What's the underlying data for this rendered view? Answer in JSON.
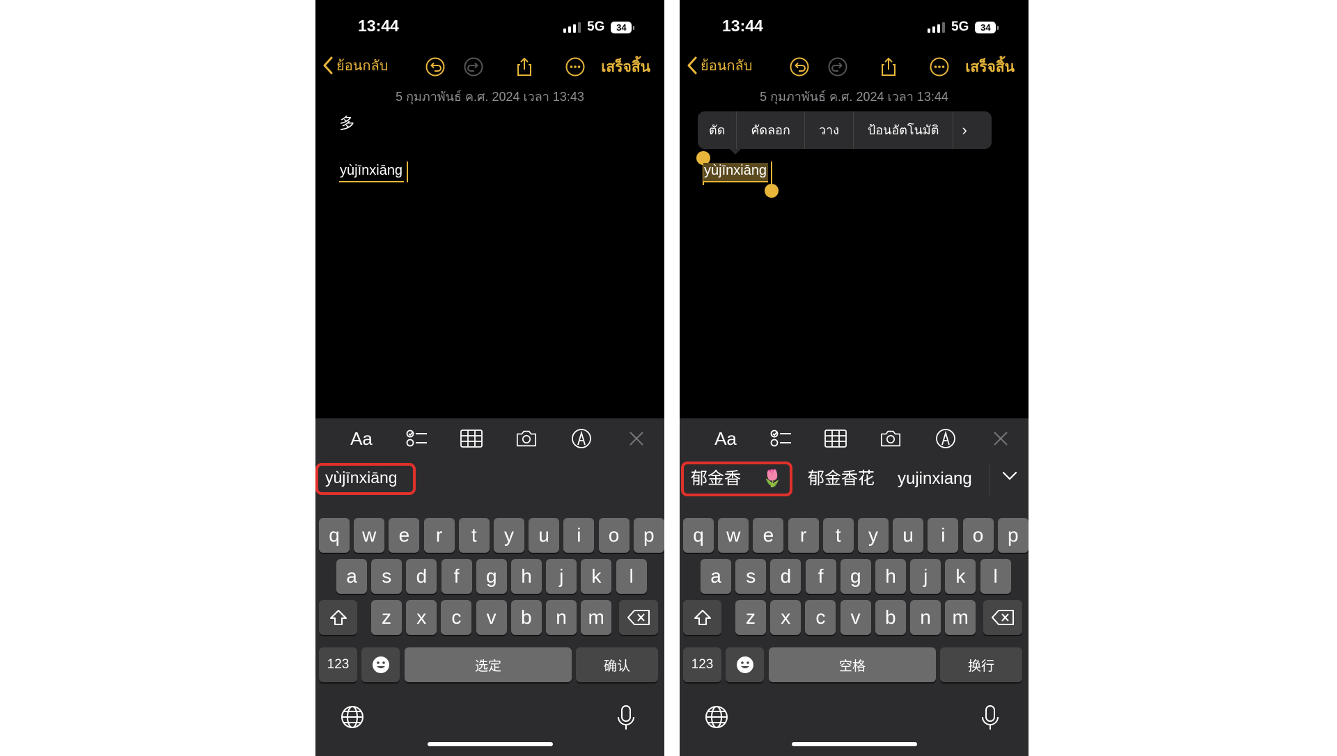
{
  "left": {
    "status": {
      "time": "13:44",
      "network": "5G",
      "battery": "34"
    },
    "toolbar": {
      "back_label": "ย้อนกลับ",
      "done_label": "เสร็จสิ้น"
    },
    "note": {
      "date": "5 กุมภาพันธ์ ค.ศ. 2024 เวลา 13:43",
      "line1": "多",
      "marked_text": "yùjīnxiāng"
    },
    "candidates": [
      "yùjīnxiāng"
    ],
    "keys": {
      "numbers": "123",
      "space": "选定",
      "return": "确认"
    }
  },
  "right": {
    "status": {
      "time": "13:44",
      "network": "5G",
      "battery": "34"
    },
    "toolbar": {
      "back_label": "ย้อนกลับ",
      "done_label": "เสร็จสิ้น"
    },
    "note": {
      "date": "5 กุมภาพันธ์ ค.ศ. 2024 เวลา 13:44",
      "marked_text": "yùjīnxiāng"
    },
    "edit_menu": [
      "ตัด",
      "คัดลอก",
      "วาง",
      "ป้อนอัตโนมัติ"
    ],
    "candidates": [
      "郁金香",
      "🌷",
      "郁金香花",
      "yujinxiang"
    ],
    "keys": {
      "numbers": "123",
      "space": "空格",
      "return": "换行"
    }
  },
  "format_bar": [
    "Aa"
  ],
  "keyboard_rows": {
    "row1": [
      "q",
      "w",
      "e",
      "r",
      "t",
      "y",
      "u",
      "i",
      "o",
      "p"
    ],
    "row2": [
      "a",
      "s",
      "d",
      "f",
      "g",
      "h",
      "j",
      "k",
      "l"
    ],
    "row3": [
      "z",
      "x",
      "c",
      "v",
      "b",
      "n",
      "m"
    ]
  },
  "icons": [
    "chevron-left-icon",
    "undo-icon",
    "redo-icon",
    "share-icon",
    "more-icon",
    "checklist-icon",
    "table-icon",
    "camera-icon",
    "markup-icon",
    "close-icon",
    "shift-icon",
    "backspace-icon",
    "emoji-icon",
    "globe-icon",
    "mic-icon",
    "chevron-down-icon"
  ],
  "colors": {
    "accent": "#e8b63a",
    "highlight_box": "#e0312b",
    "keyboard_bg": "#2c2c2e",
    "key_bg": "#6b6b6b"
  }
}
